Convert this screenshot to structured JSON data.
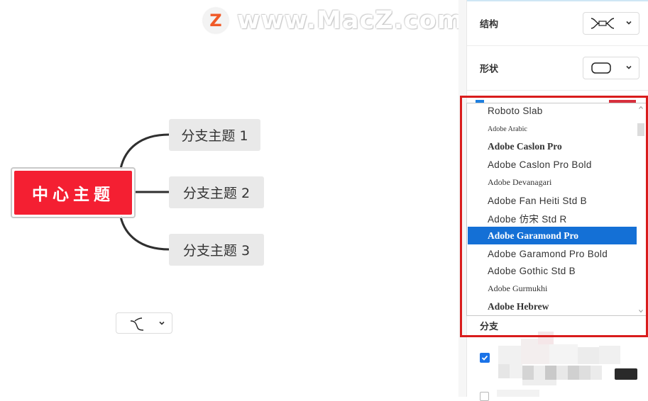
{
  "watermark": {
    "logo_letter": "Z",
    "text": "www.MacZ.com"
  },
  "mindmap": {
    "central_topic": "中心主题",
    "central_color": "#f41f32",
    "branches": [
      "分支主题 1",
      "分支主题 2",
      "分支主题 3"
    ]
  },
  "panel": {
    "structure_label": "结构",
    "shape_label": "形状",
    "branch_label": "分支",
    "accent_color": "#1a73e8",
    "highlight_color": "#d91c1c"
  },
  "font_dropdown": {
    "items": [
      "Roboto Slab",
      "Adobe Arabic",
      "Adobe Caslon Pro",
      "Adobe Caslon Pro Bold",
      "Adobe Devanagari",
      "Adobe Fan Heiti Std B",
      "Adobe 仿宋 Std R",
      "Adobe Garamond Pro",
      "Adobe Garamond Pro Bold",
      "Adobe Gothic Std B",
      "Adobe Gurmukhi",
      "Adobe Hebrew"
    ],
    "selected": "Adobe Garamond Pro",
    "selected_color": "#1470d6"
  },
  "icons": {
    "structure": "structure-map-icon",
    "shape": "rounded-rect-icon",
    "branch": "curved-branch-icon",
    "dropdown": "chevron-down-icon"
  }
}
